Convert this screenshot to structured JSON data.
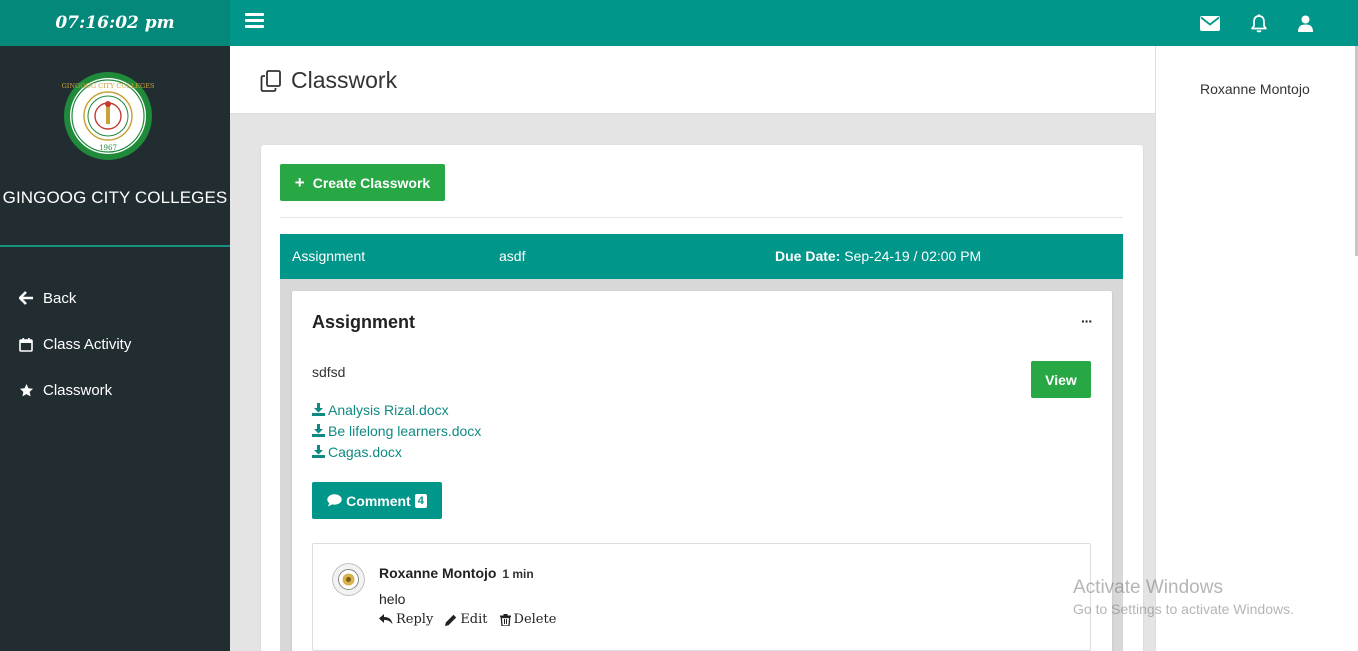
{
  "clock": "07:16:02 pm",
  "brand": {
    "name": "GINGOOG CITY COLLEGES",
    "logo_text": "GINGOOG CITY COLLEGES",
    "logo_year": "1967"
  },
  "sidebar": {
    "items": [
      {
        "label": "Back",
        "icon": "arrow-left-icon"
      },
      {
        "label": "Class Activity",
        "icon": "calendar-icon"
      },
      {
        "label": "Classwork",
        "icon": "star-icon"
      }
    ]
  },
  "topbar": {
    "icons": [
      "envelope-icon",
      "bell-icon",
      "user-icon"
    ]
  },
  "right_panel": {
    "user_name": "Roxanne Montojo"
  },
  "page": {
    "title": "Classwork"
  },
  "toolbar": {
    "create_label": "Create Classwork"
  },
  "assignment_bar": {
    "type": "Assignment",
    "name": "asdf",
    "due_label": "Due Date:",
    "due_value": " Sep-24-19 / 02:00 PM"
  },
  "assignment": {
    "heading": "Assignment",
    "menu": "···",
    "description": "sdfsd",
    "view_label": "View",
    "files": [
      "Analysis Rizal.docx",
      "Be lifelong learners.docx",
      "Cagas.docx"
    ],
    "comment_label": "Comment",
    "comment_count": "4"
  },
  "comment": {
    "author": "Roxanne Montojo",
    "time": "1 min",
    "text": "helo",
    "actions": {
      "reply": "Reply",
      "edit": "Edit",
      "delete": "Delete"
    }
  },
  "watermark": {
    "line1": "Activate Windows",
    "line2": "Go to Settings to activate Windows."
  },
  "colors": {
    "primary": "#00968a",
    "sidebar": "#222d32",
    "success": "#28a745",
    "link": "#0f8a82"
  }
}
